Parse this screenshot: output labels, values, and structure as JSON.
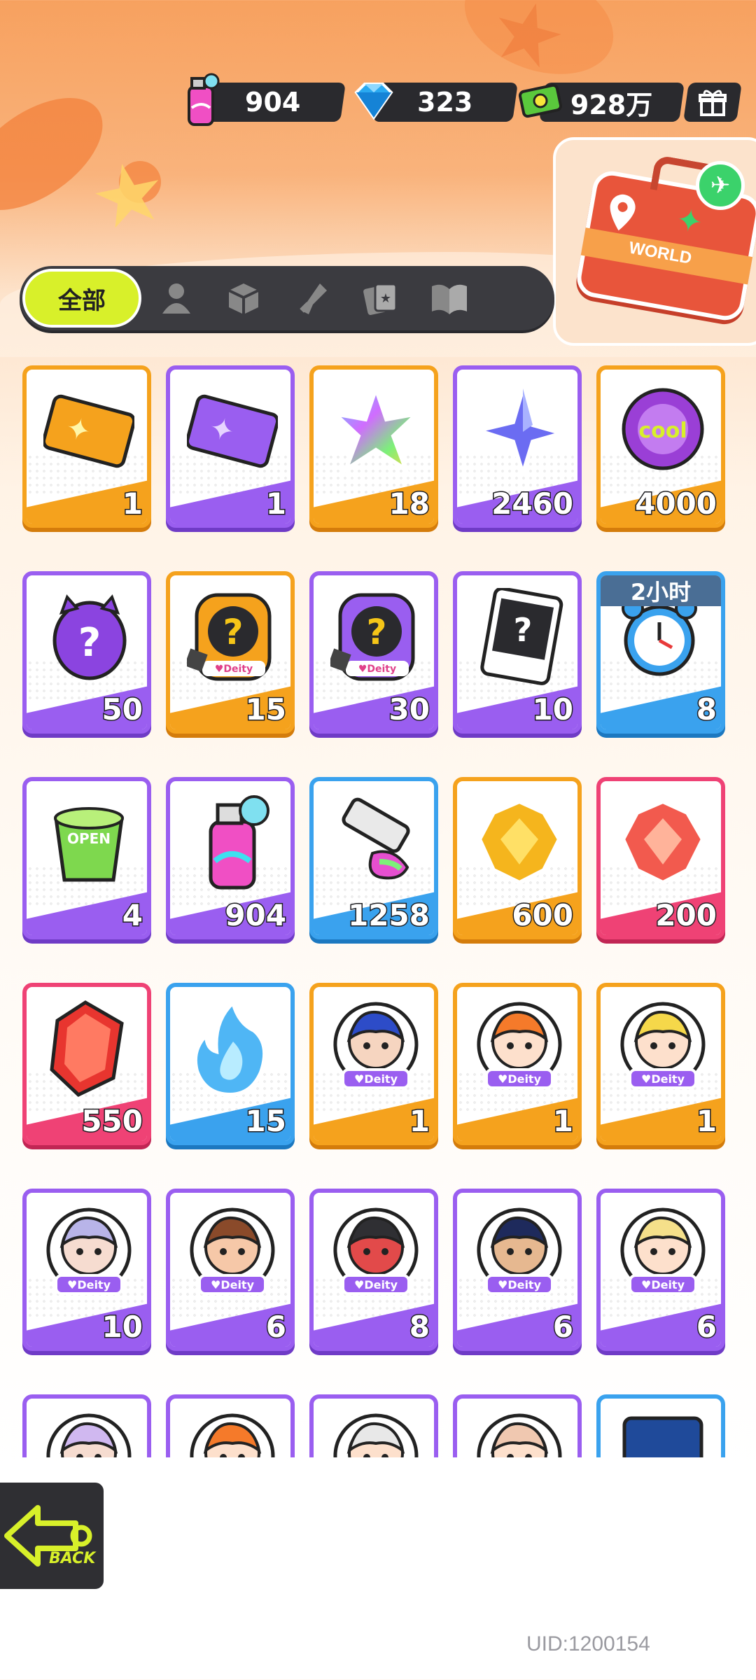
{
  "currencies": [
    {
      "icon": "spray-can-icon",
      "value": "904"
    },
    {
      "icon": "diamond-icon",
      "value": "323"
    },
    {
      "icon": "cash-icon",
      "value": "928万"
    }
  ],
  "bag_label": "WORLD",
  "tabs": {
    "active_label": "全部",
    "icons": [
      "person-icon",
      "box-icon",
      "weapon-icon",
      "cards-icon",
      "book-icon"
    ]
  },
  "colors": {
    "orange": "#f5a21d",
    "purple": "#9a5ef0",
    "blue": "#3aa2ee",
    "pink": "#ef4275",
    "lime": "#d8f02a"
  },
  "items": [
    {
      "name": "gold-ticket",
      "rarity": "orange",
      "count": "1"
    },
    {
      "name": "purple-ticket",
      "rarity": "purple",
      "count": "1"
    },
    {
      "name": "rainbow-star-shard",
      "rarity": "orange",
      "count": "18"
    },
    {
      "name": "blue-star-shard",
      "rarity": "purple",
      "count": "2460"
    },
    {
      "name": "cool-badge-token",
      "rarity": "orange",
      "count": "4000"
    },
    {
      "name": "mystery-egg",
      "rarity": "purple",
      "count": "50"
    },
    {
      "name": "gold-mystery-card",
      "rarity": "orange",
      "count": "15"
    },
    {
      "name": "purple-mystery-card",
      "rarity": "purple",
      "count": "30"
    },
    {
      "name": "travel-mystery-card",
      "rarity": "purple",
      "count": "10"
    },
    {
      "name": "alarm-clock",
      "rarity": "blue",
      "count": "8",
      "timer": "2小时"
    },
    {
      "name": "open-cup",
      "rarity": "purple",
      "count": "4"
    },
    {
      "name": "spray-can",
      "rarity": "purple",
      "count": "904"
    },
    {
      "name": "paint-tube",
      "rarity": "blue",
      "count": "1258"
    },
    {
      "name": "gold-crystal",
      "rarity": "orange",
      "count": "600"
    },
    {
      "name": "pink-crystal",
      "rarity": "pink",
      "count": "200"
    },
    {
      "name": "red-gem",
      "rarity": "pink",
      "count": "550"
    },
    {
      "name": "blue-flame",
      "rarity": "blue",
      "count": "15"
    },
    {
      "name": "deity-blue-hair",
      "rarity": "orange",
      "count": "1"
    },
    {
      "name": "deity-orange-hair",
      "rarity": "orange",
      "count": "1"
    },
    {
      "name": "deity-blonde-cap",
      "rarity": "orange",
      "count": "1"
    },
    {
      "name": "deity-silver-hair",
      "rarity": "purple",
      "count": "10"
    },
    {
      "name": "deity-goggles",
      "rarity": "purple",
      "count": "6"
    },
    {
      "name": "deity-green-mask",
      "rarity": "purple",
      "count": "8"
    },
    {
      "name": "deity-dark-hair",
      "rarity": "purple",
      "count": "6"
    },
    {
      "name": "deity-sunglasses",
      "rarity": "purple",
      "count": "6"
    },
    {
      "name": "deity-partial-1",
      "rarity": "purple",
      "count": ""
    },
    {
      "name": "deity-partial-2",
      "rarity": "purple",
      "count": ""
    },
    {
      "name": "deity-partial-3",
      "rarity": "purple",
      "count": ""
    },
    {
      "name": "deity-partial-4",
      "rarity": "purple",
      "count": ""
    },
    {
      "name": "card-partial-5",
      "rarity": "blue",
      "count": ""
    }
  ],
  "back_label": "BACK",
  "uid": "UID:1200154"
}
